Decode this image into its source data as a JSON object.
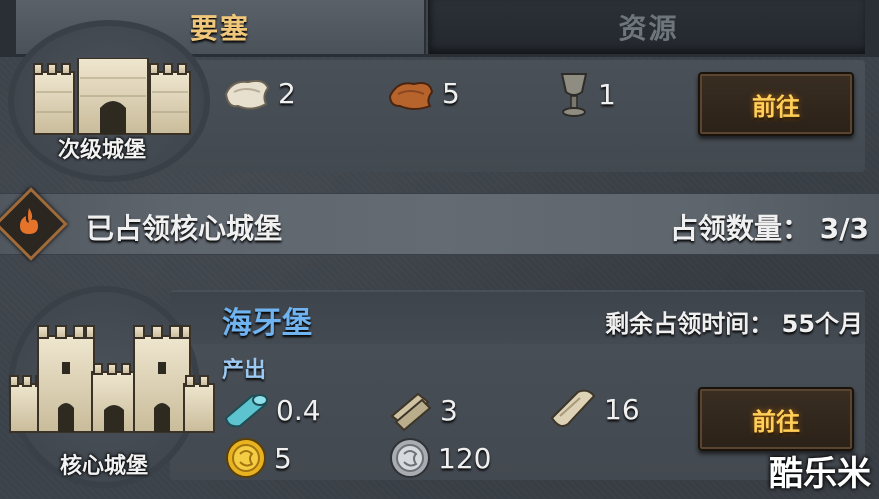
{
  "tabs": {
    "active": "要塞",
    "inactive": "资源"
  },
  "castle1": {
    "label": "次级城堡",
    "resources": [
      {
        "icon": "cloth-icon",
        "value": "2"
      },
      {
        "icon": "leather-icon",
        "value": "5"
      },
      {
        "icon": "goblet-icon",
        "value": "1"
      }
    ],
    "button": "前往"
  },
  "banner": {
    "title": "已占领核心城堡",
    "count_label": "占领数量：",
    "count": "3/3"
  },
  "castle2": {
    "name": "海牙堡",
    "remaining_label": "剩余占领时间：",
    "remaining_value": "55个月",
    "output_label": "产出",
    "label": "核心城堡",
    "resources": [
      {
        "icon": "silk-icon",
        "value": "0.4"
      },
      {
        "icon": "scroll-icon",
        "value": "3"
      },
      {
        "icon": "parchment-icon",
        "value": "16"
      },
      {
        "icon": "gold-coin-icon",
        "value": "5"
      },
      {
        "icon": "silver-coin-icon",
        "value": "120"
      }
    ],
    "button": "前往"
  },
  "watermark": "酷乐米",
  "colors": {
    "accent_gold": "#f0c77a",
    "name_blue": "#6fb3f0",
    "button_text": "#ffcf5a"
  }
}
